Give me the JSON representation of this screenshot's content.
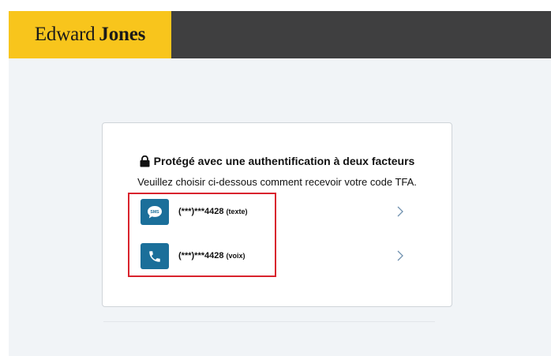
{
  "brand": {
    "first": "Edward",
    "second": "Jones",
    "color": "#f8c51c",
    "header_color": "#3f3f40"
  },
  "auth": {
    "title": "Protégé avec une authentification à deux facteurs",
    "subtitle": "Veuillez choisir ci-dessous comment recevoir votre code TFA.",
    "lock_icon": "lock-icon",
    "options": [
      {
        "icon": "sms-icon",
        "icon_text": "SMS",
        "number": "(***)***4428",
        "kind": "(texte)"
      },
      {
        "icon": "phone-icon",
        "number": "(***)***4428",
        "kind": "(voix)"
      }
    ],
    "accent_color": "#1b6f9a",
    "highlight_color": "#d9232d"
  }
}
